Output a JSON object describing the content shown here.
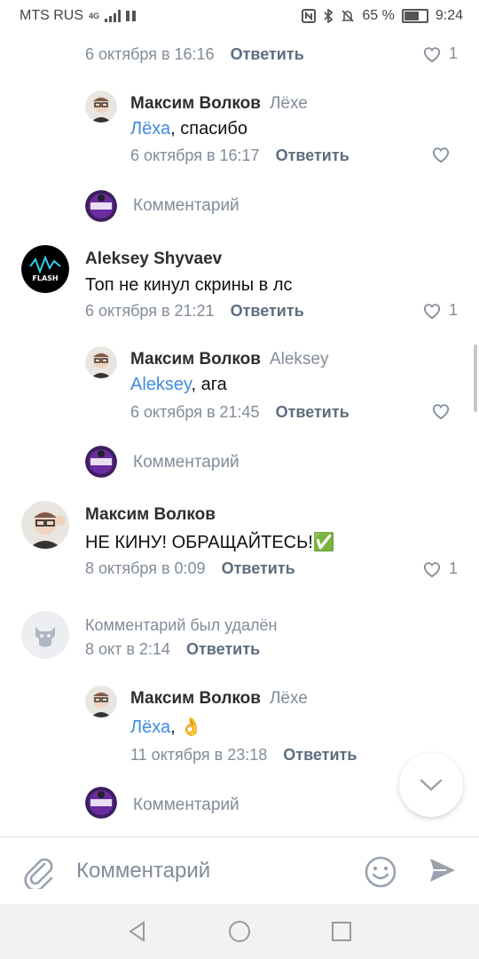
{
  "status_bar": {
    "carrier": "MTS RUS",
    "network": "4G",
    "battery_percent": "65 %",
    "time": "9:24"
  },
  "comments": [
    {
      "id": "c1",
      "kind": "meta_only",
      "meta_date": "6 октября в 16:16",
      "reply_label": "Ответить",
      "likes": "1"
    },
    {
      "id": "c2",
      "kind": "reply",
      "author": "Максим Волков",
      "addressee": "Лёхе",
      "mention": "Лёха",
      "text": ", спасибо",
      "meta_date": "6 октября в 16:17",
      "reply_label": "Ответить",
      "likes": ""
    },
    {
      "id": "c3",
      "kind": "placeholder",
      "placeholder": "Комментарий"
    },
    {
      "id": "c4",
      "kind": "top",
      "author": "Aleksey Shyvaev",
      "text": "Топ не кинул скрины в лс",
      "meta_date": "6 октября в 21:21",
      "reply_label": "Ответить",
      "likes": "1"
    },
    {
      "id": "c5",
      "kind": "reply",
      "author": "Максим Волков",
      "addressee": "Aleksey",
      "mention": "Aleksey",
      "text": ", ага",
      "meta_date": "6 октября в 21:45",
      "reply_label": "Ответить",
      "likes": ""
    },
    {
      "id": "c6",
      "kind": "placeholder",
      "placeholder": "Комментарий"
    },
    {
      "id": "c7",
      "kind": "top",
      "author": "Максим Волков",
      "text": "НЕ КИНУ! ОБРАЩАЙТЕСЬ!✅",
      "meta_date": "8 октября в 0:09",
      "reply_label": "Ответить",
      "likes": "1"
    },
    {
      "id": "c8",
      "kind": "deleted",
      "deleted_text": "Комментарий был удалён",
      "meta_date": "8 окт в 2:14",
      "reply_label": "Ответить"
    },
    {
      "id": "c9",
      "kind": "reply",
      "author": "Максим Волков",
      "addressee": "Лёхе",
      "mention": "Лёха",
      "text": ", 👌",
      "meta_date": "11 октября в 23:18",
      "reply_label": "Ответить",
      "likes": ""
    },
    {
      "id": "c10",
      "kind": "placeholder",
      "placeholder": "Комментарий"
    }
  ],
  "composer": {
    "placeholder": "Комментарий"
  },
  "colors": {
    "link": "#3f8ae0",
    "secondary_text": "#818c99",
    "reply_link": "#5d6d80"
  },
  "icons": [
    "paperclip-icon",
    "smile-icon",
    "send-icon",
    "heart-icon",
    "chevron-down-icon",
    "back-icon",
    "home-icon",
    "recents-icon",
    "deleted-user-icon"
  ]
}
